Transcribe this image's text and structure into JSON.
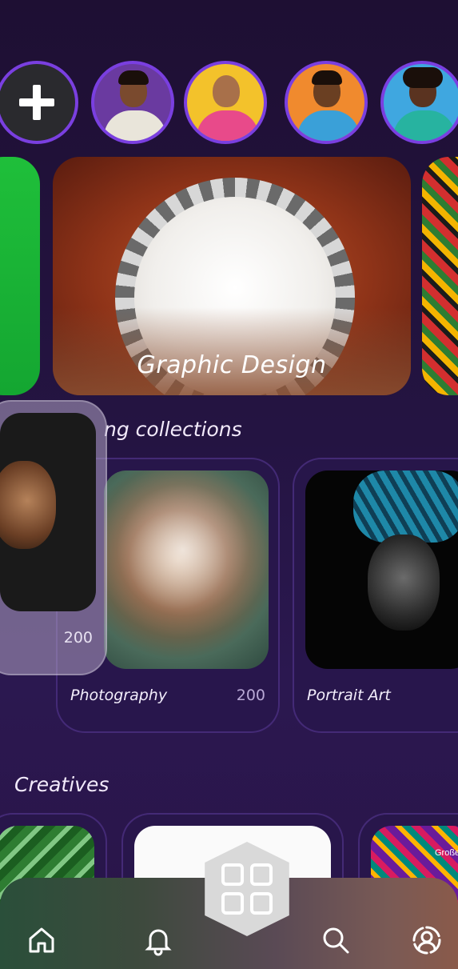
{
  "stories": {
    "add_label": "",
    "items": [
      {
        "name": "story-1",
        "bg": "#6a3aa0",
        "shirt": "#e9e5da",
        "skin": "#7a4a2e"
      },
      {
        "name": "story-2",
        "bg": "#f3c22b",
        "shirt": "#e84a8a",
        "skin": "#a8704a"
      },
      {
        "name": "story-3",
        "bg": "#f08a2e",
        "shirt": "#3aa0d8",
        "skin": "#6a3f22"
      },
      {
        "name": "story-4",
        "bg": "#3fa7e0",
        "shirt": "#27b3a0",
        "skin": "#5a3320"
      }
    ]
  },
  "featured": {
    "main_label": "Graphic Design"
  },
  "collections": {
    "title": "ng collections",
    "items": [
      {
        "name": "Photography",
        "count": "200"
      },
      {
        "name": "Portrait Art",
        "count": ""
      }
    ],
    "floating": {
      "count": "200"
    }
  },
  "creatives": {
    "title": "Creatives",
    "colorful_caption": "Große"
  },
  "nav": {
    "items": [
      "home-icon",
      "bell-icon",
      "grid-icon",
      "search-icon",
      "profile-icon"
    ]
  }
}
